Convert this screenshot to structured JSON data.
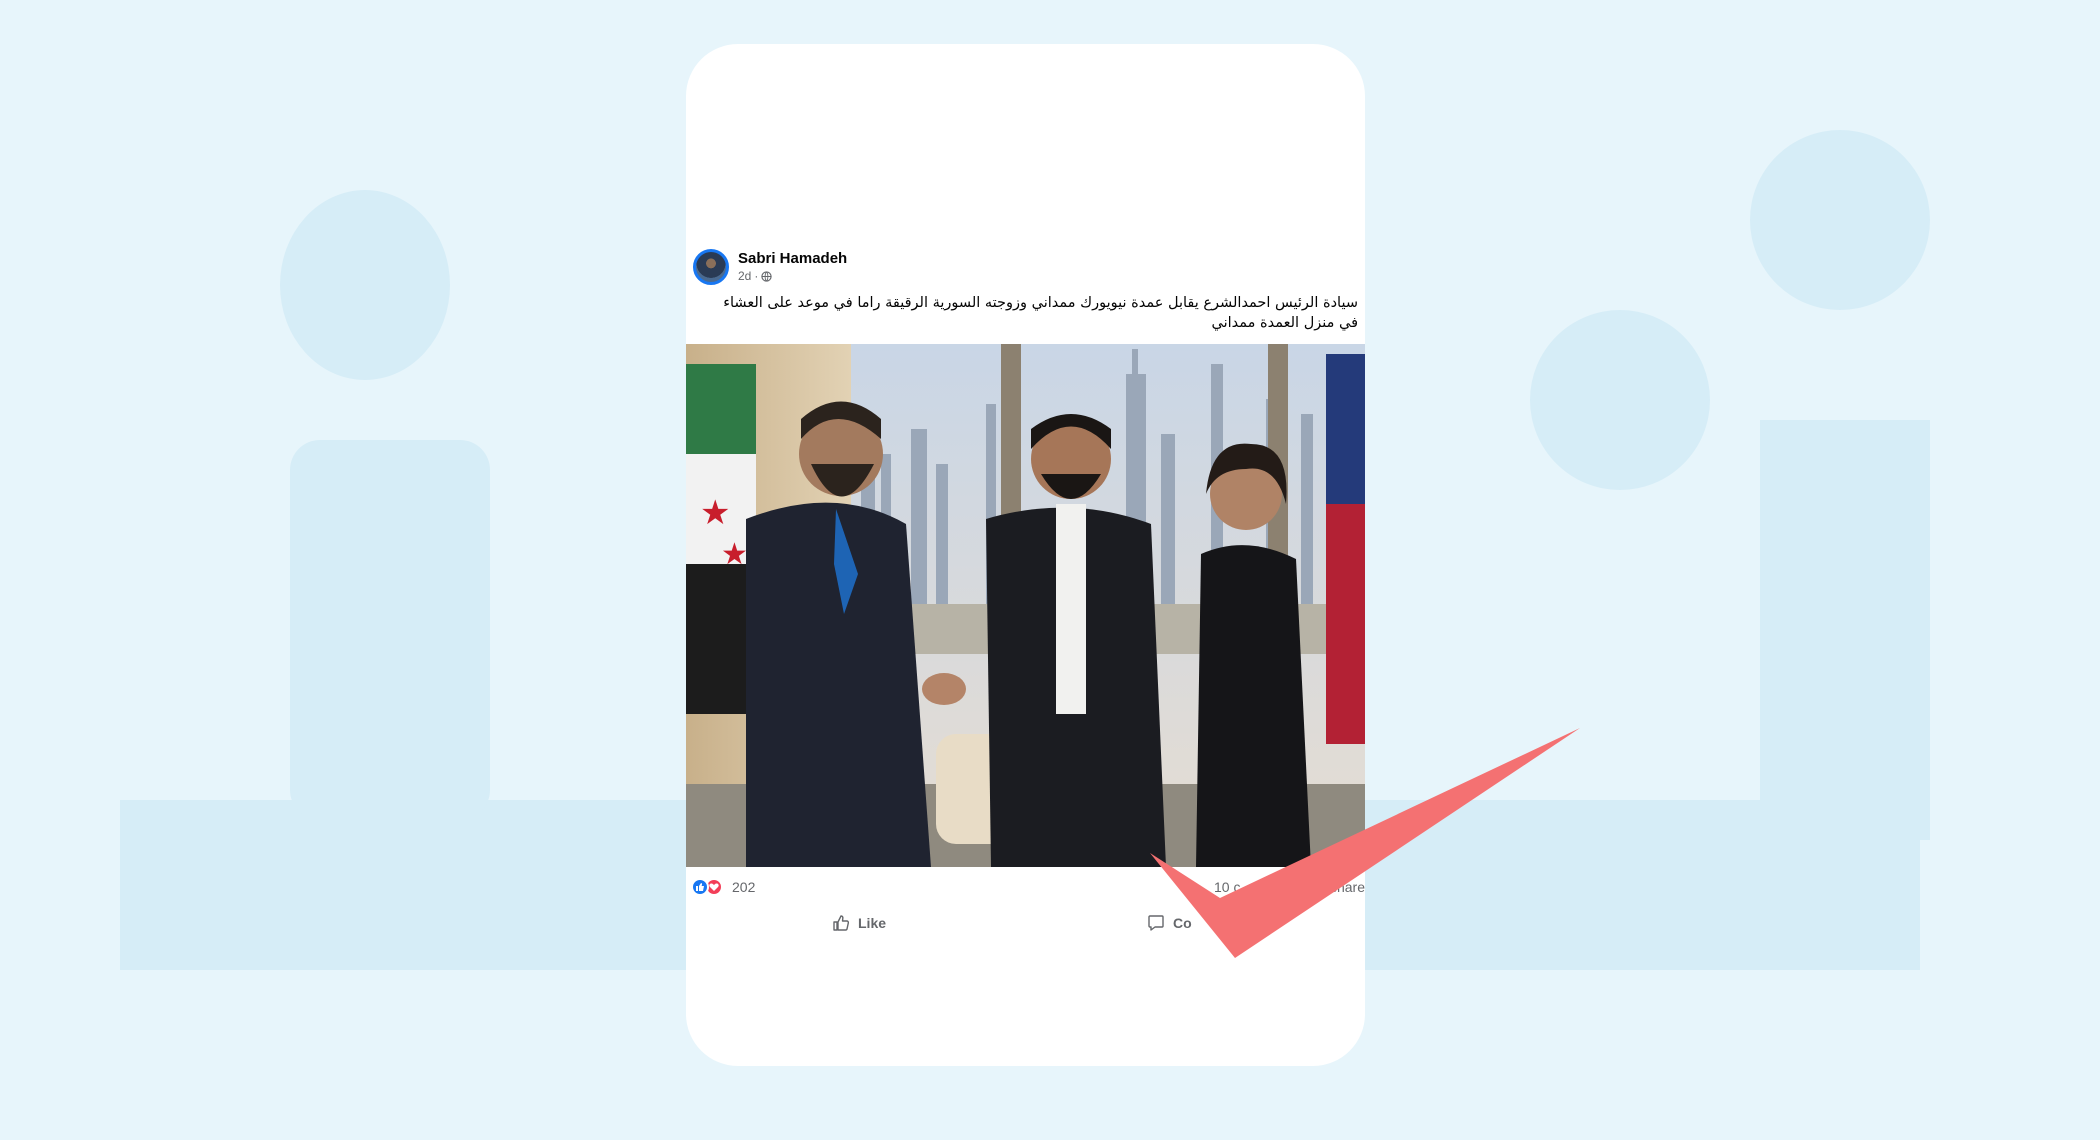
{
  "post": {
    "author": "Sabri Hamadeh",
    "time": "2d",
    "separator": "·",
    "caption": "سيادة الرئيس احمدالشرع يقابل عمدة نيويورك ممداني وزوجته السورية الرقيقة راما في موعد على العشاء في منزل العمدة ممداني",
    "reactions_count": "202",
    "comments_count": "10 c",
    "shares_label": "share",
    "like_label": "Like",
    "comment_label": "Co"
  },
  "icons": {
    "audience": "globe-icon",
    "reactions": [
      "like-reaction-icon",
      "love-reaction-icon"
    ],
    "overlay": "red-checkmark-icon"
  },
  "colors": {
    "brand_blue": "#1877f2",
    "love_red": "#f33e58",
    "checkmark_red": "#f47172",
    "page_background": "#e7f5fb"
  }
}
